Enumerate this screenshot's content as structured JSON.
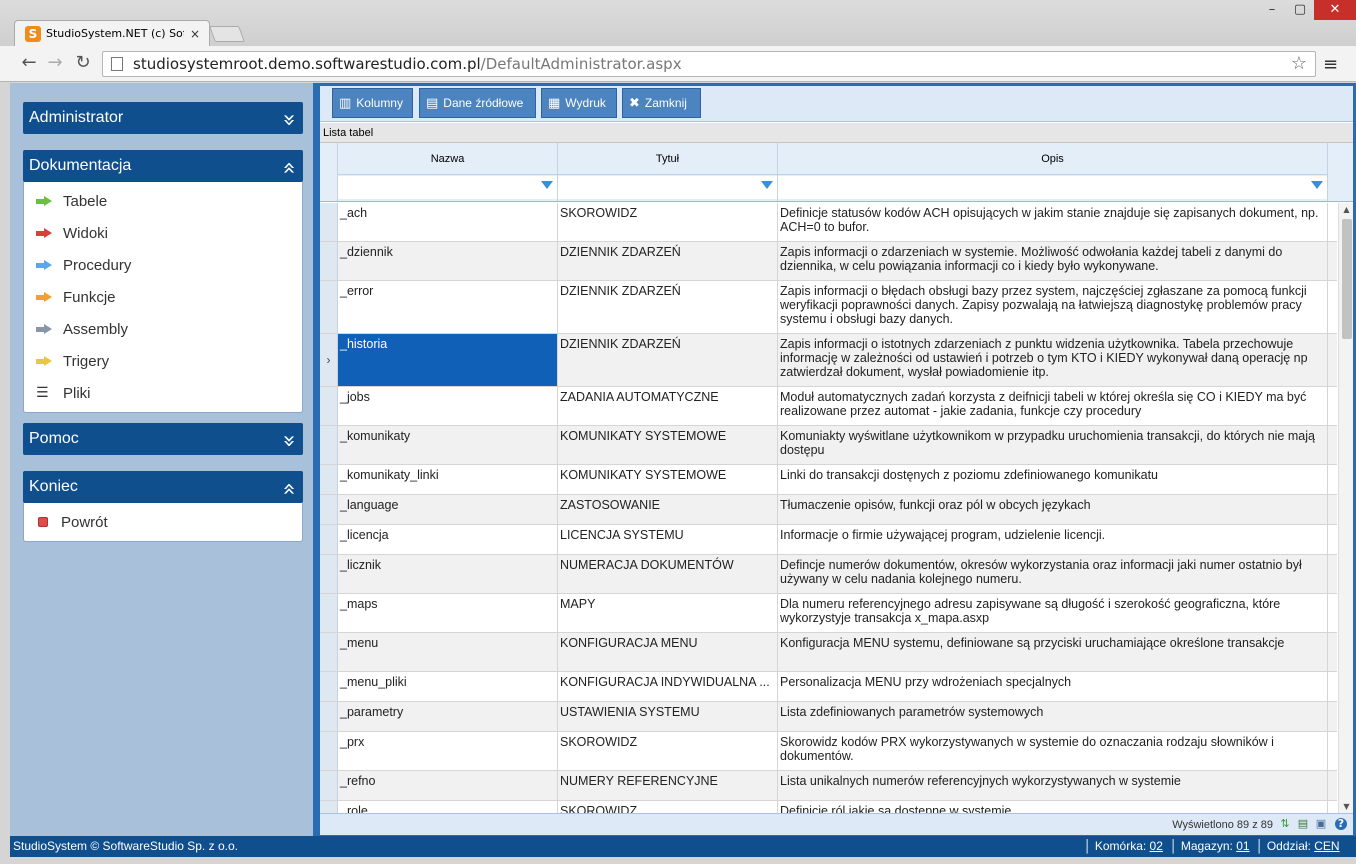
{
  "browser": {
    "tab_title": "StudioSystem.NET (c) Software",
    "tab_close": "×",
    "url_host": "studiosystemroot.demo.softwarestudio.com.pl",
    "url_path": "/DefaultAdministrator.aspx",
    "minimize": "–",
    "maximize": "▢",
    "close": "✕",
    "back": "←",
    "forward": "→",
    "reload": "↻",
    "star": "☆",
    "menu": "≡",
    "logo_letter": "S"
  },
  "sidebar": {
    "administrator": {
      "title": "Administrator",
      "chevron": "»"
    },
    "dokumentacja": {
      "title": "Dokumentacja",
      "chevron": "«",
      "items": [
        {
          "label": "Tabele",
          "icon": "green-arrow-icon",
          "color": "#6bbf3a"
        },
        {
          "label": "Widoki",
          "icon": "red-arrow-icon",
          "color": "#d9403a"
        },
        {
          "label": "Procedury",
          "icon": "blue-arrow-icon",
          "color": "#5aa6e6"
        },
        {
          "label": "Funkcje",
          "icon": "orange-arrow-icon",
          "color": "#f0a030"
        },
        {
          "label": "Assembly",
          "icon": "gray-arrow-icon",
          "color": "#8a96a8"
        },
        {
          "label": "Trigery",
          "icon": "yellow-arrow-icon",
          "color": "#e8c840"
        },
        {
          "label": "Pliki",
          "icon": "list-icon",
          "glyph": "☰"
        }
      ]
    },
    "pomoc": {
      "title": "Pomoc",
      "chevron": "»"
    },
    "koniec": {
      "title": "Koniec",
      "chevron": "«",
      "items": [
        {
          "label": "Powrót",
          "icon": "stop-icon"
        }
      ]
    }
  },
  "toolbar": {
    "kolumny": {
      "label": "Kolumny",
      "icon": "▥"
    },
    "dane": {
      "label": "Dane źródłowe",
      "icon": "▤"
    },
    "wydruk": {
      "label": "Wydruk",
      "icon": "▦"
    },
    "zamknij": {
      "label": "Zamknij",
      "icon": "✖"
    }
  },
  "grid": {
    "caption": "Lista tabel",
    "columns": {
      "nazwa": "Nazwa",
      "tytul": "Tytuł",
      "opis": "Opis"
    },
    "selected_marker": "›",
    "rows": [
      {
        "nazwa": "_ach",
        "tytul": "SKOROWIDZ",
        "opis": "Definicje statusów kodów ACH opisujących w jakim stanie znajduje się zapisanych dokument, np. ACH=0 to bufor."
      },
      {
        "nazwa": "_dziennik",
        "tytul": "DZIENNIK ZDARZEŃ",
        "opis": "Zapis informacji o zdarzeniach w systemie. Możliwość odwołania każdej tabeli z danymi do dziennika, w celu powiązania informacji co i kiedy było wykonywane."
      },
      {
        "nazwa": "_error",
        "tytul": "DZIENNIK ZDARZEŃ",
        "opis": "Zapis informacji o błędach obsługi bazy przez system, najczęściej zgłaszane za pomocą funkcji weryfikacji poprawności danych. Zapisy pozwalają na łatwiejszą diagnostykę problemów pracy systemu i obsługi bazy danych."
      },
      {
        "nazwa": "_historia",
        "tytul": "DZIENNIK ZDARZEŃ",
        "opis": "Zapis informacji o istotnych zdarzeniach z punktu widzenia użytkownika. Tabela przechowuje informację w zależności od ustawień i potrzeb o tym KTO i KIEDY wykonywał daną operację np zatwierdzał dokument, wysłał powiadomienie itp."
      },
      {
        "nazwa": "_jobs",
        "tytul": "ZADANIA AUTOMATYCZNE",
        "opis": "Moduł automatycznych zadań korzysta z deifnicji tabeli w której określa się CO i KIEDY ma być realizowane przez automat - jakie zadania, funkcje czy procedury"
      },
      {
        "nazwa": "_komunikaty",
        "tytul": "KOMUNIKATY SYSTEMOWE",
        "opis": "Komuniakty wyświtlane użytkownikom w przypadku uruchomienia transakcji, do których nie mają dostępu"
      },
      {
        "nazwa": "_komunikaty_linki",
        "tytul": "KOMUNIKATY SYSTEMOWE",
        "opis": "Linki do transakcji dostęnych z poziomu zdefiniowanego komunikatu"
      },
      {
        "nazwa": "_language",
        "tytul": "ZASTOSOWANIE",
        "opis": "Tłumaczenie opisów, funkcji oraz pól w obcych językach"
      },
      {
        "nazwa": "_licencja",
        "tytul": "LICENCJA SYSTEMU",
        "opis": "Informacje o firmie używającej program, udzielenie licencji."
      },
      {
        "nazwa": "_licznik",
        "tytul": "NUMERACJA DOKUMENTÓW",
        "opis": "Defincje numerów dokumentów, okresów wykorzystania oraz informacji jaki numer ostatnio był używany w celu nadania kolejnego numeru."
      },
      {
        "nazwa": "_maps",
        "tytul": "MAPY",
        "opis": "Dla numeru referencyjnego adresu zapisywane są długość i szerokość geograficzna, które wykorzystyje transakcja x_mapa.asxp"
      },
      {
        "nazwa": "_menu",
        "tytul": "KONFIGURACJA MENU",
        "opis": "Konfiguracja MENU systemu, definiowane są przyciski uruchamiające określone transakcje"
      },
      {
        "nazwa": "_menu_pliki",
        "tytul": "KONFIGURACJA INDYWIDUALNA ...",
        "opis": "Personalizacja MENU przy wdrożeniach specjalnych"
      },
      {
        "nazwa": "_parametry",
        "tytul": "USTAWIENIA SYSTEMU",
        "opis": "Lista zdefiniowanych parametrów systemowych"
      },
      {
        "nazwa": "_prx",
        "tytul": "SKOROWIDZ",
        "opis": "Skorowidz kodów PRX wykorzystywanych w systemie do oznaczania rodzaju słowników i dokumentów."
      },
      {
        "nazwa": "_refno",
        "tytul": "NUMERY REFERENCYJNE",
        "opis": "Lista unikalnych numerów referencyjnych wykorzystywanych w systemie"
      },
      {
        "nazwa": "_role",
        "tytul": "SKOROWIDZ",
        "opis": "Definicje ról jakie są dostępne w systemie"
      }
    ],
    "shown": "Wyświetlono 89 z 89",
    "scroll_up": "▲",
    "scroll_down": "▼"
  },
  "footer": {
    "copyright": "StudioSystem © SoftwareStudio Sp. z o.o.",
    "komorka_label": "Komórka:",
    "komorka_value": "02",
    "magazyn_label": "Magazyn:",
    "magazyn_value": "01",
    "oddzial_label": "Oddział:",
    "oddzial_value": "CEN"
  }
}
